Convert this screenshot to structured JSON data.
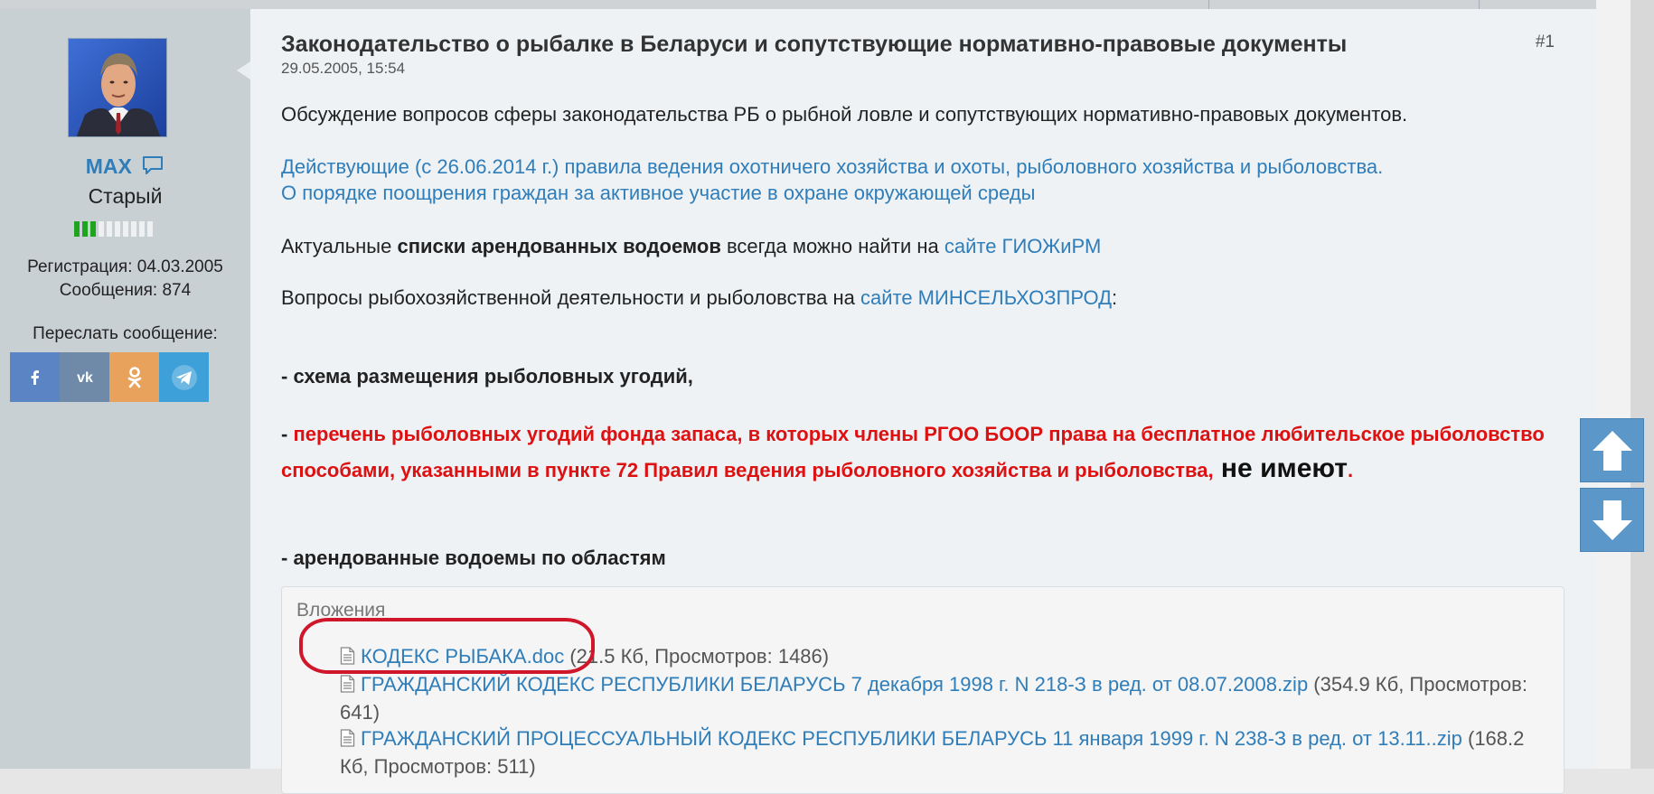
{
  "user": {
    "name": "MAX",
    "title": "Старый",
    "reputation_filled": 3,
    "reputation_total": 10,
    "registration": "Регистрация: 04.03.2005",
    "messages": "Сообщения: 874",
    "share_label": "Переслать сообщение:",
    "share_buttons": [
      "facebook-icon",
      "vk-icon",
      "odnoklassniki-icon",
      "telegram-icon"
    ]
  },
  "post": {
    "title": "Законодательство о рыбалке в Беларуси и сопутствующие нормативно-правовые документы",
    "number": "#1",
    "date": "29.05.2005, 15:54",
    "intro": "Обсуждение вопросов сферы законодательства РБ о рыбной ловле и сопутствующих нормативно-правовых документов.",
    "link_rules": "Действующие (с 26.06.2014 г.) правила ведения охотничего хозяйства и охоты, рыболовного хозяйства и рыболовства.",
    "link_encouragement": "О порядке поощрения граждан за активное участие в охране окружающей среды",
    "line_rented_a": "Актуальные ",
    "line_rented_bold": "списки арендованных водоемов",
    "line_rented_b": " всегда можно найти на ",
    "line_rented_link": "сайте ГИОЖиРМ",
    "line_ministry_a": "Вопросы рыбохозяйственной деятельности и рыболовства на ",
    "line_ministry_link": "сайте МИНСЕЛЬХОЗПРОД",
    "line_ministry_b": ":",
    "scheme": "- схема размещения рыболовных угодий,",
    "reserve_dash": "- ",
    "reserve_red": "перечень рыболовных угодий фонда запаса, в которых члены РГОО БООР права на бесплатное любительское рыболовство способами, указанными в пункте 72 Правил ведения рыболовного хозяйства и рыболовства,",
    "reserve_big": " не имеют",
    "reserve_dot": ".",
    "rented_by_region": "- арендованные водоемы по областям"
  },
  "attachments": {
    "title": "Вложения",
    "items": [
      {
        "name": "КОДЕКС РЫБАКА.doc",
        "meta": " (21.5 Кб, Просмотров: 1486)"
      },
      {
        "name": "ГРАЖДАНСКИЙ КОДЕКС РЕСПУБЛИКИ БЕЛАРУСЬ 7 декабря 1998 г. N 218-З в ред. от 08.07.2008.zip",
        "meta": " (354.9 Кб, Просмотров: 641)"
      },
      {
        "name": "ГРАЖДАНСКИЙ ПРОЦЕССУАЛЬНЫЙ КОДЕКС РЕСПУБЛИКИ БЕЛАРУСЬ 11 января 1999 г. N 238-З в ред. от 13.11..zip",
        "meta": " (168.2 Кб, Просмотров: 511)"
      }
    ]
  },
  "colors": {
    "link": "#2f7db9",
    "warning": "#dd1111",
    "reputation_on": "#1fa41f",
    "scroll_button": "#5b97c9",
    "highlight": "#d0162a"
  }
}
